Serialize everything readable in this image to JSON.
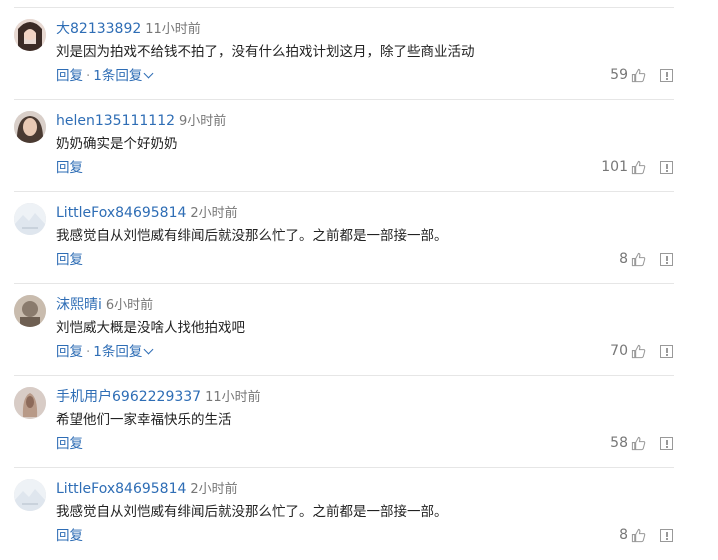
{
  "comments": [
    {
      "user": "大82133892",
      "time": "11小时前",
      "text": "刘是因为拍戏不给钱不拍了，没有什么拍戏计划这月，除了些商业活动",
      "reply": "回复",
      "replies": "1条回复",
      "likes": "59",
      "avatar_color": "#3b2b26"
    },
    {
      "user": "helen135111112",
      "time": "9小时前",
      "text": "奶奶确实是个好奶奶",
      "reply": "回复",
      "replies": null,
      "likes": "101",
      "avatar_color": "#4a3a32"
    },
    {
      "user": "LittleFox84695814",
      "time": "2小时前",
      "text": "我感觉自从刘恺威有绯闻后就没那么忙了。之前都是一部接一部。",
      "reply": "回复",
      "replies": null,
      "likes": "8",
      "avatar_color": "#dfe6ee"
    },
    {
      "user": "沫熙晴i",
      "time": "6小时前",
      "text": "刘恺威大概是没啥人找他拍戏吧",
      "reply": "回复",
      "replies": "1条回复",
      "likes": "70",
      "avatar_color": "#8a7b6d"
    },
    {
      "user": "手机用户6962229337",
      "time": "11小时前",
      "text": "希望他们一家幸福快乐的生活",
      "reply": "回复",
      "replies": null,
      "likes": "58",
      "avatar_color": "#b89a88"
    },
    {
      "user": "LittleFox84695814",
      "time": "2小时前",
      "text": "我感觉自从刘恺威有绯闻后就没那么忙了。之前都是一部接一部。",
      "reply": "回复",
      "replies": null,
      "likes": "8",
      "avatar_color": "#dfe6ee"
    }
  ],
  "icons": {
    "like": "thumbs-up-icon",
    "report": "report-icon",
    "expand": "chevron-down-icon"
  }
}
